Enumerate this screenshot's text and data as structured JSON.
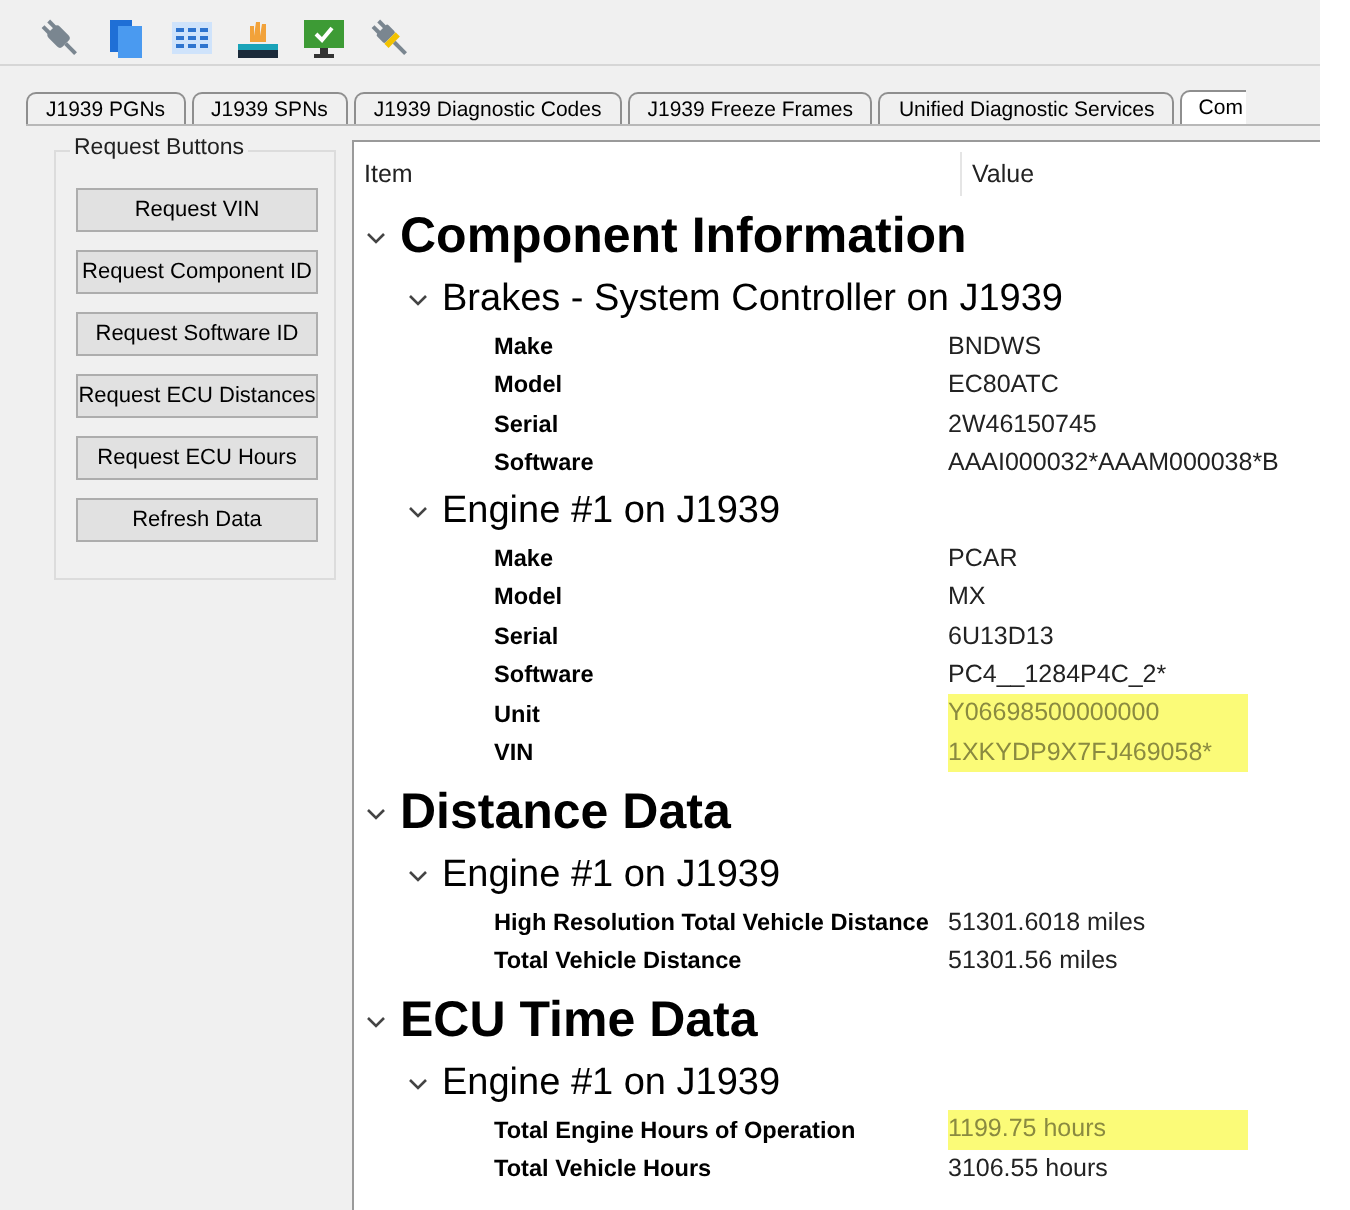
{
  "toolbar": {
    "icons": [
      {
        "kind": "plug"
      },
      {
        "kind": "documents"
      },
      {
        "kind": "table"
      },
      {
        "kind": "tray"
      },
      {
        "kind": "monitor"
      },
      {
        "kind": "plug-yellow"
      }
    ]
  },
  "tabs": [
    {
      "label": "J1939 PGNs",
      "selected": false
    },
    {
      "label": "J1939 SPNs",
      "selected": false
    },
    {
      "label": "J1939 Diagnostic Codes",
      "selected": false
    },
    {
      "label": "J1939 Freeze Frames",
      "selected": false
    },
    {
      "label": "Unified Diagnostic Services",
      "selected": false
    },
    {
      "label": "Com",
      "selected": true
    }
  ],
  "request_group": {
    "title": "Request Buttons",
    "buttons": [
      "Request VIN",
      "Request Component ID",
      "Request Software ID",
      "Request ECU Distances",
      "Request ECU Hours",
      "Refresh Data"
    ]
  },
  "tree": {
    "columns": [
      "Item",
      "Value"
    ],
    "sections": [
      {
        "title": "Component Information",
        "expanded": true,
        "children": [
          {
            "title": "Brakes - System Controller on J1939",
            "expanded": true,
            "rows": [
              {
                "label": "Make",
                "value": "BNDWS",
                "highlighted": false
              },
              {
                "label": "Model",
                "value": "EC80ATC",
                "highlighted": false
              },
              {
                "label": "Serial",
                "value": "2W46150745",
                "highlighted": false
              },
              {
                "label": "Software",
                "value": "AAAI000032*AAAM000038*B",
                "highlighted": false
              }
            ]
          },
          {
            "title": "Engine #1 on J1939",
            "expanded": true,
            "rows": [
              {
                "label": "Make",
                "value": "PCAR",
                "highlighted": false
              },
              {
                "label": "Model",
                "value": "MX",
                "highlighted": false
              },
              {
                "label": "Serial",
                "value": "6U13D13",
                "highlighted": false
              },
              {
                "label": "Software",
                "value": "PC4__1284P4C_2*",
                "highlighted": false
              },
              {
                "label": "Unit",
                "value": "Y06698500000000",
                "highlighted": true
              },
              {
                "label": "VIN",
                "value": "1XKYDP9X7FJ469058*",
                "highlighted": true
              }
            ]
          }
        ]
      },
      {
        "title": "Distance Data",
        "expanded": true,
        "children": [
          {
            "title": "Engine #1 on J1939",
            "expanded": true,
            "rows": [
              {
                "label": "High Resolution Total Vehicle Distance",
                "value": "51301.6018 miles",
                "highlighted": false
              },
              {
                "label": "Total Vehicle Distance",
                "value": "51301.56 miles",
                "highlighted": false
              }
            ]
          }
        ]
      },
      {
        "title": "ECU Time Data",
        "expanded": true,
        "children": [
          {
            "title": "Engine #1 on J1939",
            "expanded": true,
            "rows": [
              {
                "label": "Total Engine Hours of Operation",
                "value": "1199.75 hours",
                "highlighted": true
              },
              {
                "label": "Total Vehicle Hours",
                "value": "3106.55 hours",
                "highlighted": false
              }
            ]
          }
        ]
      }
    ]
  }
}
